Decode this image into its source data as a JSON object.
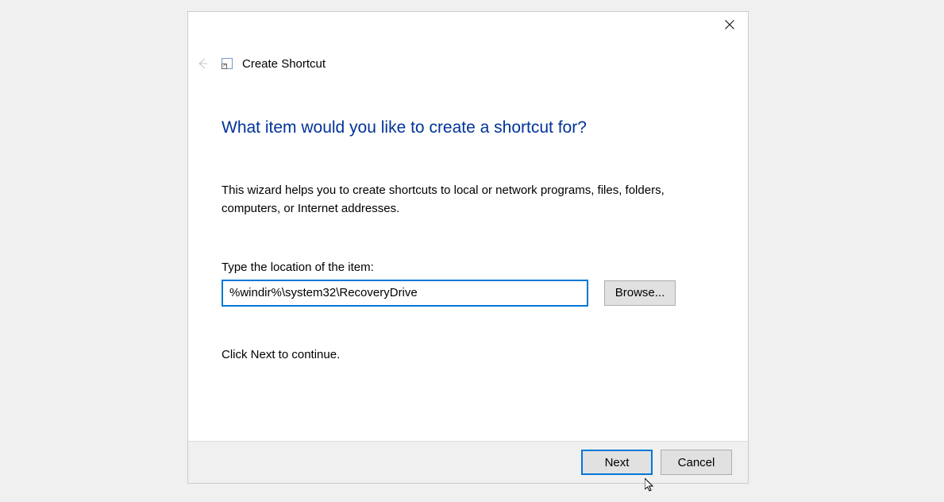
{
  "dialog": {
    "title": "Create Shortcut",
    "heading": "What item would you like to create a shortcut for?",
    "description": "This wizard helps you to create shortcuts to local or network programs, files, folders, computers, or Internet addresses.",
    "field_label": "Type the location of the item:",
    "path_value": "%windir%\\system32\\RecoveryDrive",
    "browse_label": "Browse...",
    "continue_text": "Click Next to continue.",
    "next_label": "Next",
    "cancel_label": "Cancel"
  }
}
